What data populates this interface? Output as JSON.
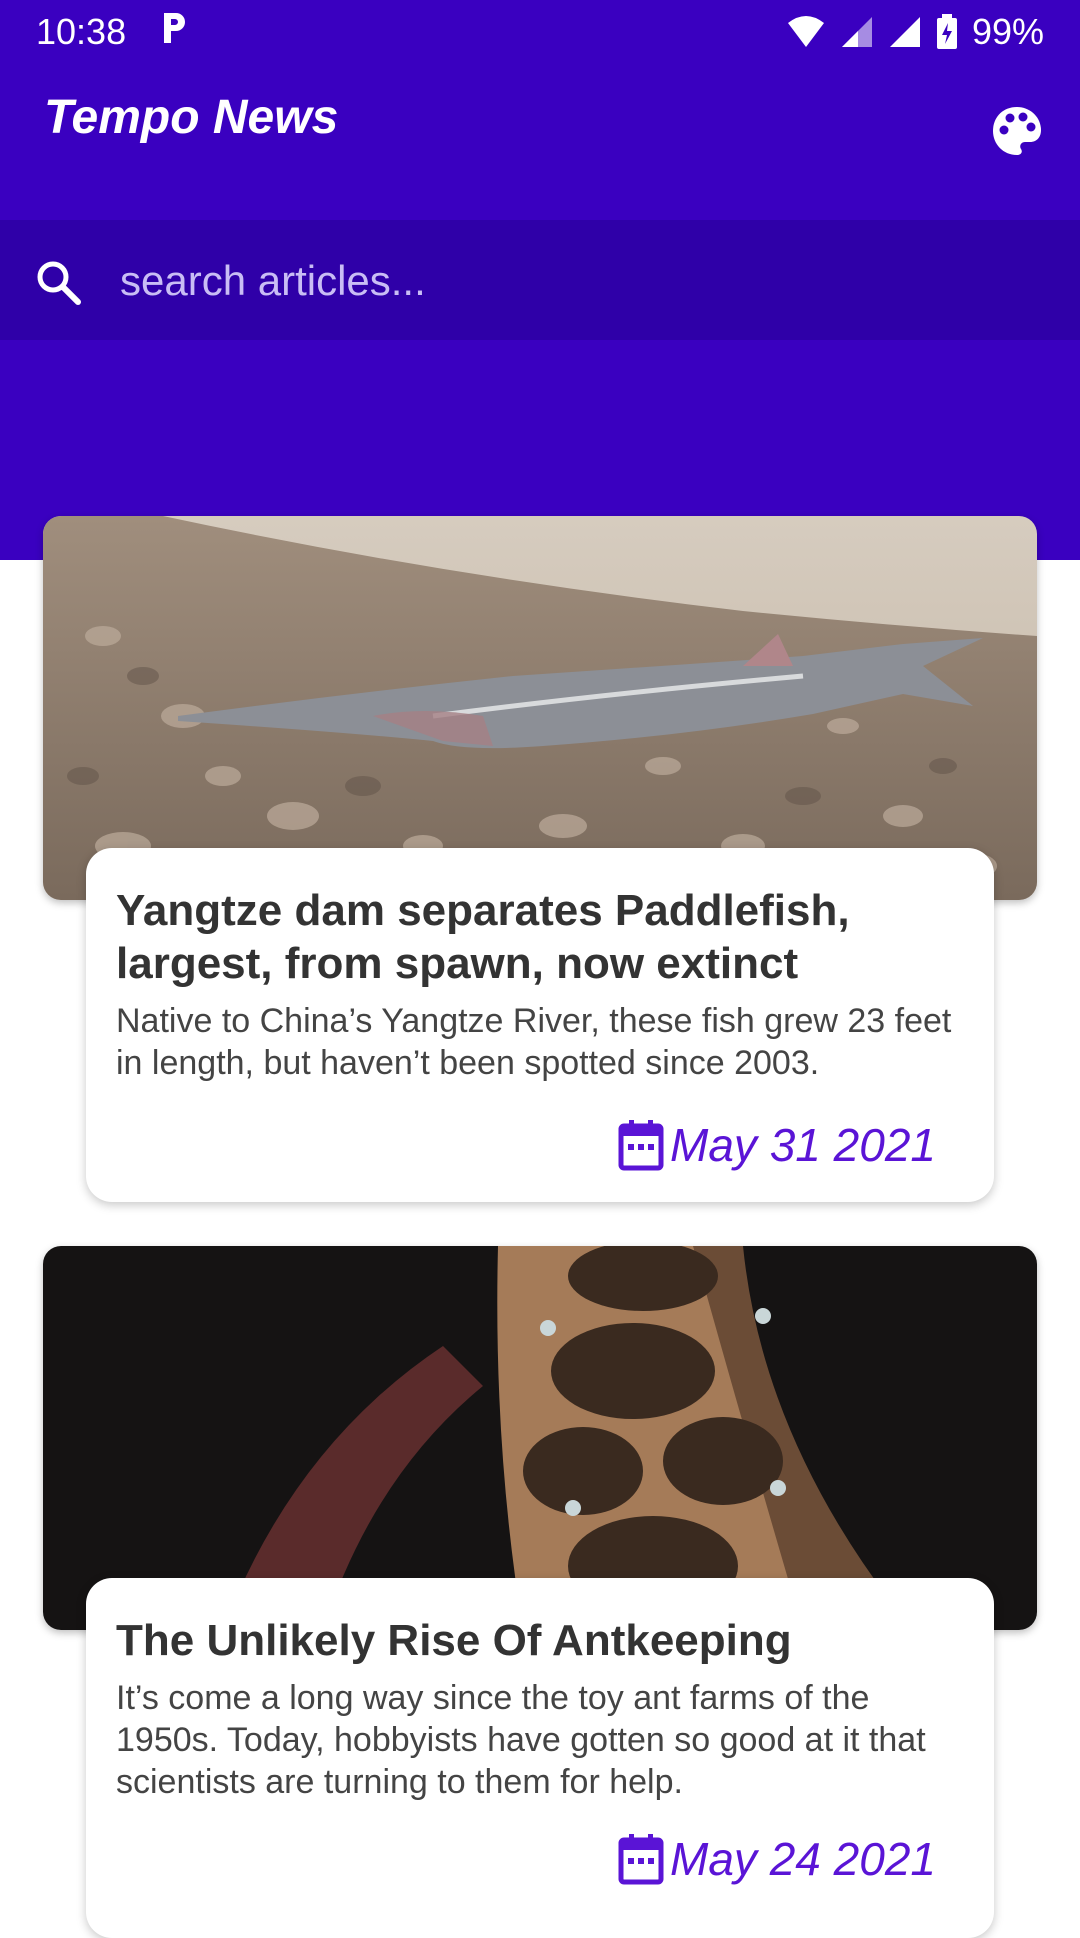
{
  "status_bar": {
    "time": "10:38",
    "notification_icon": "p-icon",
    "battery": "99%"
  },
  "app": {
    "title": "Tempo News",
    "theme_icon": "palette-icon",
    "accent_color": "#3a00c0",
    "date_color": "#5a14d6"
  },
  "search": {
    "placeholder": "search articles...",
    "value": ""
  },
  "articles": [
    {
      "title": "Yangtze dam separates Paddlefish, largest, from spawn, now extinct",
      "summary": "Native to China’s Yangtze River, these fish grew 23 feet in length, but haven’t been spotted since 2003.",
      "date": "May 31 2021"
    },
    {
      "title": "The Unlikely Rise Of Antkeeping",
      "summary": "It’s come a long way since the toy ant farms of the 1950s. Today, hobbyists have gotten so good at it that scientists are turning to them for help.",
      "date": "May 24 2021"
    }
  ]
}
